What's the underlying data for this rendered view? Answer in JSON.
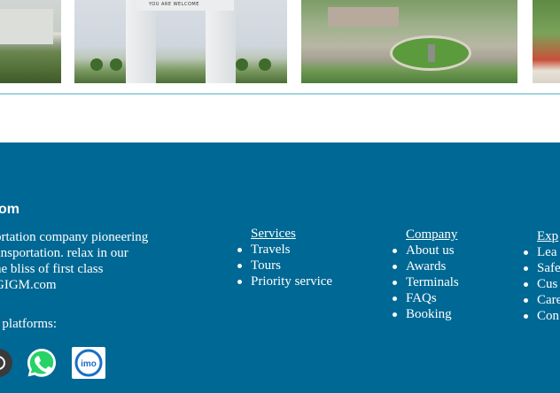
{
  "gallery": {
    "arch_sign_text": "YOU ARE WELCOME"
  },
  "footer": {
    "brand": "om",
    "about_lines": [
      "ortation company pioneering",
      "ansportation. relax in our",
      "he bliss of first class",
      "GIGM.com"
    ],
    "social_label": "a platforms:",
    "social_icons": [
      "partial-social-icon",
      "whatsapp-icon",
      "imo-icon"
    ],
    "columns": {
      "services": {
        "heading": "Services",
        "items": [
          "Travels",
          "Tours",
          "Priority service"
        ]
      },
      "company": {
        "heading": "Company",
        "items": [
          "About us",
          "Awards",
          "Terminals",
          "FAQs",
          "Booking"
        ]
      },
      "explore": {
        "heading": "Exp",
        "items": [
          "Lea",
          "Safe",
          "Cus",
          "Care",
          "Con"
        ]
      }
    },
    "colors": {
      "background": "#006894",
      "text": "#ffffff",
      "divider": "#9fd3e0",
      "whatsapp": "#25d366",
      "imo": "#1a6fc4"
    }
  }
}
